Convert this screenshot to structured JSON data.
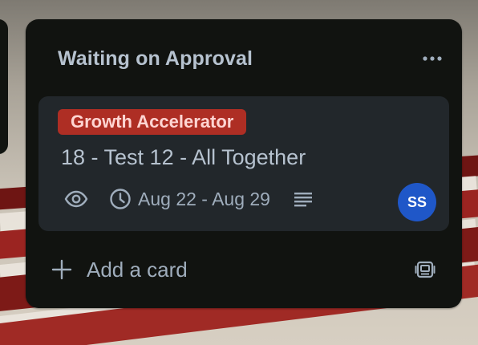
{
  "list": {
    "title": "Waiting on Approval",
    "menu_icon": "ellipsis-icon"
  },
  "card": {
    "label": {
      "text": "Growth Accelerator",
      "color": "#ae2e24"
    },
    "title": "18 - Test 12 - All Together",
    "badges": {
      "watch_icon": "eye-icon",
      "date_icon": "clock-icon",
      "date_range": "Aug 22 - Aug 29",
      "description_icon": "description-icon"
    },
    "member": {
      "initials": "SS",
      "color": "#1f57c8"
    }
  },
  "footer": {
    "add_card_label": "Add a card",
    "add_icon": "plus-icon",
    "template_icon": "card-template-icon"
  },
  "colors": {
    "list_bg": "#111310",
    "card_bg": "#22272b",
    "text": "#b6c2cf",
    "subtle_text": "#9fadbc"
  }
}
